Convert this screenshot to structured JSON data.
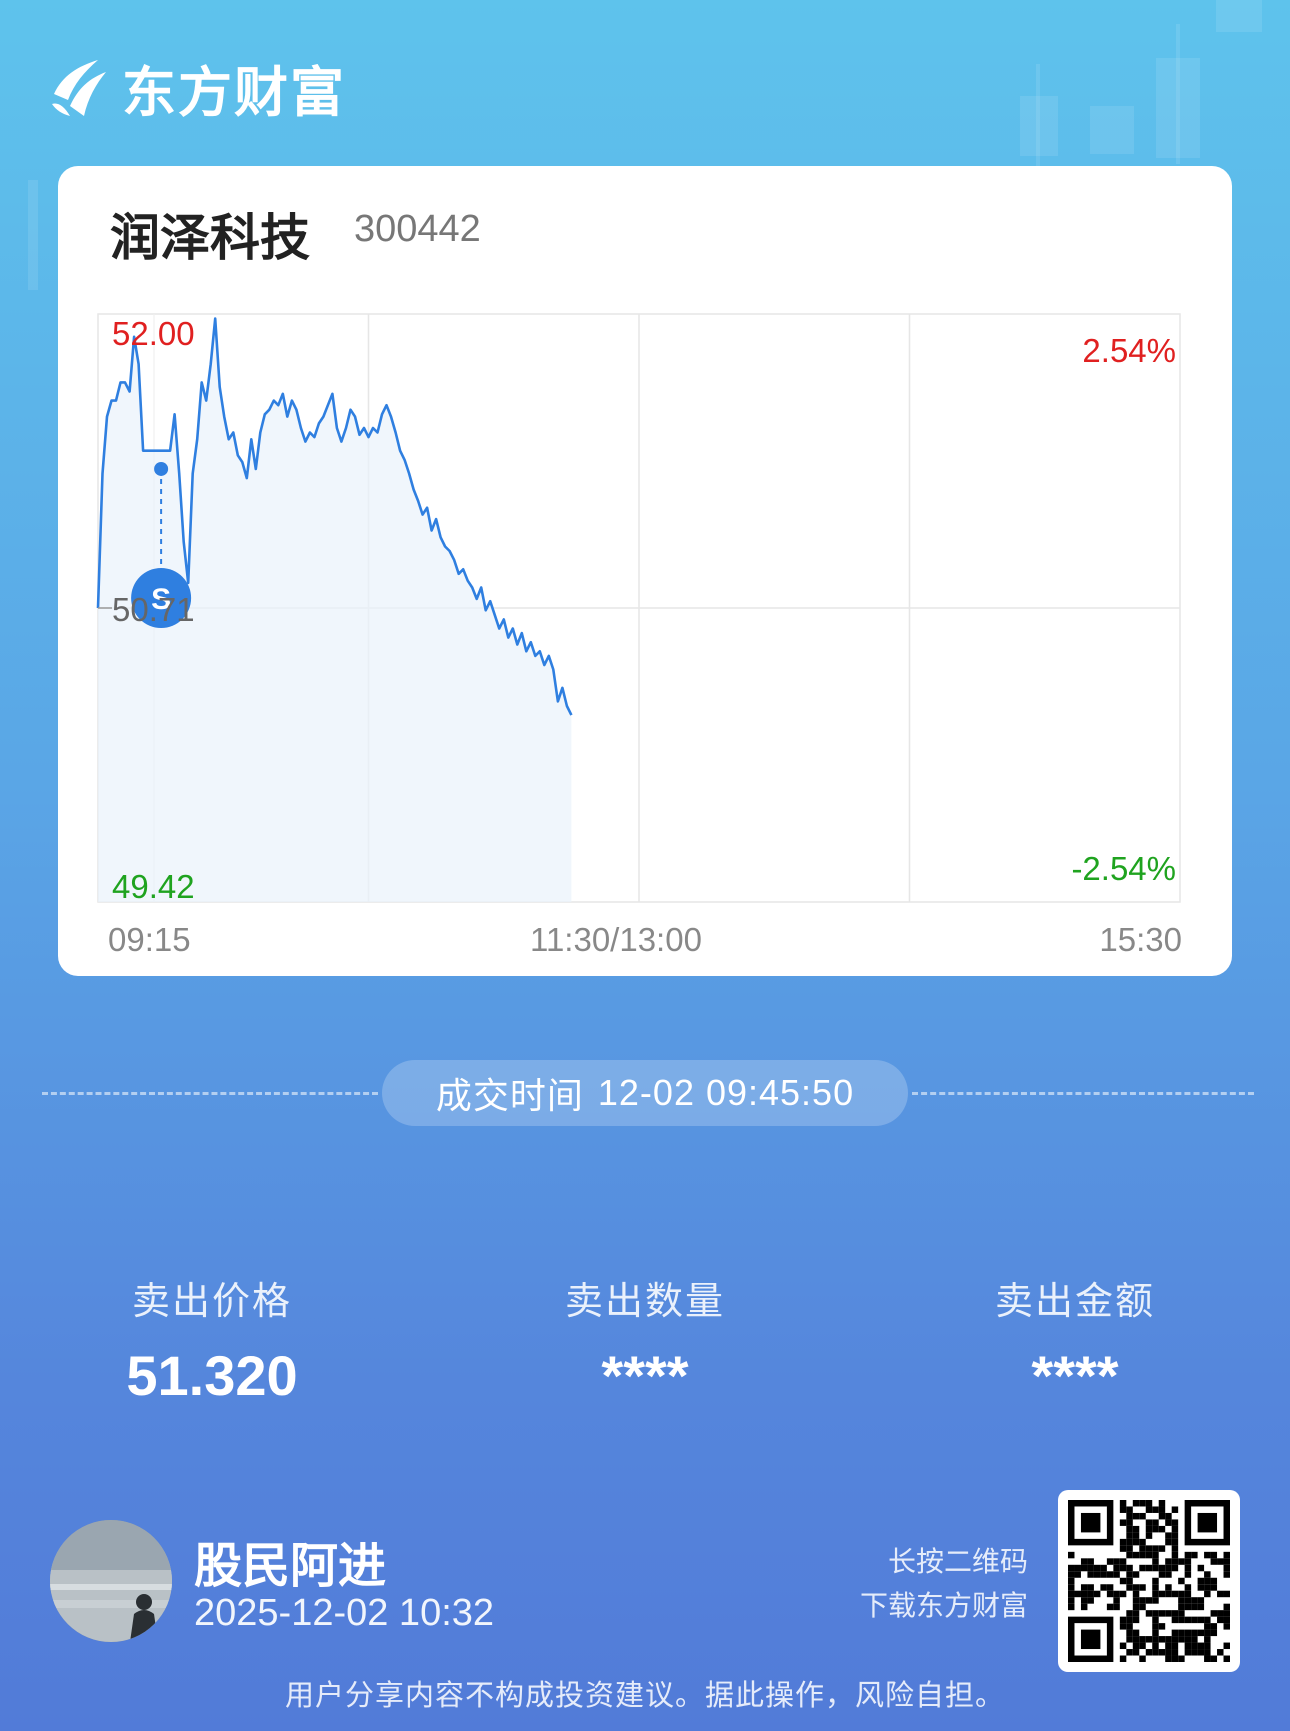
{
  "app": {
    "brand": "东方财富",
    "brand_mark": "dongfang-caifu-logo"
  },
  "stock": {
    "name": "润泽科技",
    "code": "300442"
  },
  "chart_data": {
    "type": "line",
    "y_labels": {
      "high": "52.00",
      "prev_close": "50.71",
      "low": "49.42"
    },
    "pct_labels": {
      "high": "2.54%",
      "low": "-2.54%"
    },
    "ylim": [
      49.42,
      52.0
    ],
    "x_labels": [
      "09:15",
      "11:30/13:00",
      "15:30"
    ],
    "grid": true,
    "marker": {
      "label": "S",
      "time_index": 14,
      "price": 51.32,
      "color": "#2f7fe0"
    },
    "line_color": "#2f7fe0",
    "up_color": "#e02020",
    "down_color": "#1fa31f",
    "series": [
      {
        "values": [
          50.71,
          51.3,
          51.55,
          51.62,
          51.62,
          51.7,
          51.7,
          51.66,
          51.9,
          51.78,
          51.4,
          51.4,
          51.4,
          51.4,
          51.4,
          51.4,
          51.4,
          51.56,
          51.3,
          51.0,
          50.82,
          51.3,
          51.45,
          51.7,
          51.62,
          51.78,
          51.98,
          51.68,
          51.55,
          51.45,
          51.48,
          51.38,
          51.35,
          51.28,
          51.45,
          51.32,
          51.48,
          51.56,
          51.58,
          51.62,
          51.6,
          51.65,
          51.55,
          51.62,
          51.58,
          51.5,
          51.44,
          51.48,
          51.46,
          51.52,
          51.55,
          51.6,
          51.65,
          51.5,
          51.44,
          51.5,
          51.58,
          51.55,
          51.47,
          51.5,
          51.46,
          51.5,
          51.48,
          51.56,
          51.6,
          51.55,
          51.48,
          51.4,
          51.36,
          51.3,
          51.23,
          51.18,
          51.12,
          51.15,
          51.05,
          51.1,
          51.02,
          50.98,
          50.96,
          50.92,
          50.86,
          50.88,
          50.83,
          50.8,
          50.75,
          50.8,
          50.7,
          50.74,
          50.68,
          50.62,
          50.66,
          50.58,
          50.62,
          50.55,
          50.6,
          50.52,
          50.56,
          50.5,
          50.52,
          50.46,
          50.5,
          50.44,
          50.3,
          50.36,
          50.28,
          50.24
        ]
      }
    ]
  },
  "trade": {
    "time_label": "成交时间",
    "time_value": "12-02 09:45:50",
    "price_label": "卖出价格",
    "price_value": "51.320",
    "qty_label": "卖出数量",
    "qty_value": "****",
    "amount_label": "卖出金额",
    "amount_value": "****"
  },
  "user": {
    "name": "股民阿进",
    "time": "2025-12-02 10:32"
  },
  "qr": {
    "hint_line1": "长按二维码",
    "hint_line2": "下载东方财富"
  },
  "footer": {
    "disclaimer": "用户分享内容不构成投资建议。据此操作，风险自担。"
  }
}
